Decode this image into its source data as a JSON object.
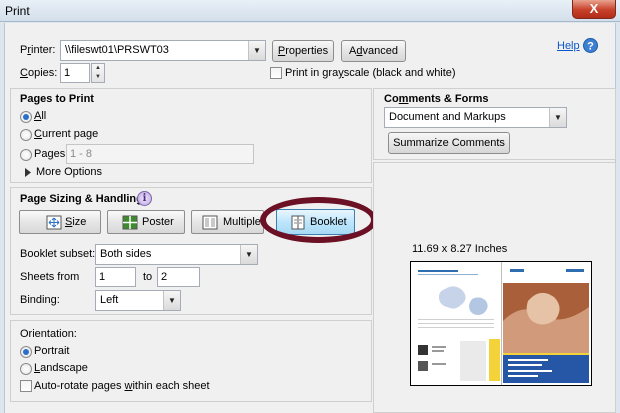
{
  "window": {
    "title": "Print",
    "close_glyph": "X"
  },
  "help": {
    "label": "Help",
    "icon": "help-icon"
  },
  "printer": {
    "label_pre": "P",
    "label_ul": "r",
    "label_post": "inter:",
    "value": "\\\\fileswt01\\PRSWT03",
    "properties_pre": "",
    "properties_ul": "P",
    "properties_post": "roperties",
    "advanced_pre": "A",
    "advanced_ul": "d",
    "advanced_post": "vanced"
  },
  "copies": {
    "label_pre": "",
    "label_ul": "C",
    "label_post": "opies:",
    "value": "1"
  },
  "grayscale": {
    "label_pre": "Print in gra",
    "label_ul": "y",
    "label_post": "scale (black and white)",
    "checked": false
  },
  "pages_to_print": {
    "title": "Pages to Print",
    "all_pre": "",
    "all_ul": "A",
    "all_post": "ll",
    "current_pre": "",
    "current_ul": "C",
    "current_post": "urrent page",
    "pages_pre": "Pa",
    "pages_ul": "g",
    "pages_post": "es",
    "pages_value": "1 - 8",
    "more_options": "More Options",
    "selected": "all"
  },
  "page_sizing": {
    "title": "Page Sizing & Handling",
    "info_glyph": "i",
    "buttons": {
      "size_pre": "",
      "size_ul": "S",
      "size_post": "ize",
      "poster": "Poster",
      "multiple": "Multiple",
      "booklet": "Booklet"
    },
    "active": "booklet",
    "booklet_subset_label": "Booklet subset:",
    "booklet_subset_value": "Both sides",
    "sheets_from_label": "Sheets from",
    "sheets_from_value": "1",
    "sheets_to_label": "to",
    "sheets_to_value": "2",
    "binding_label": "Binding:",
    "binding_value": "Left"
  },
  "orientation": {
    "title": "Orientation:",
    "portrait": "Portrait",
    "landscape_pre": "",
    "landscape_ul": "L",
    "landscape_post": "andscape",
    "autorotate_pre": "Auto-rotate pages ",
    "autorotate_ul": "w",
    "autorotate_post": "ithin each sheet",
    "selected": "portrait",
    "autorotate_checked": false
  },
  "comments_forms": {
    "title_pre": "Co",
    "title_ul": "m",
    "title_post": "ments & Forms",
    "value": "Document and Markups",
    "summarize": "Summarize Comments"
  },
  "preview": {
    "size_text": "11.69 x 8.27 Inches"
  },
  "colors": {
    "accent": "#2a6fc9",
    "ring": "#6b1025",
    "help_link": "#0b57c9"
  }
}
